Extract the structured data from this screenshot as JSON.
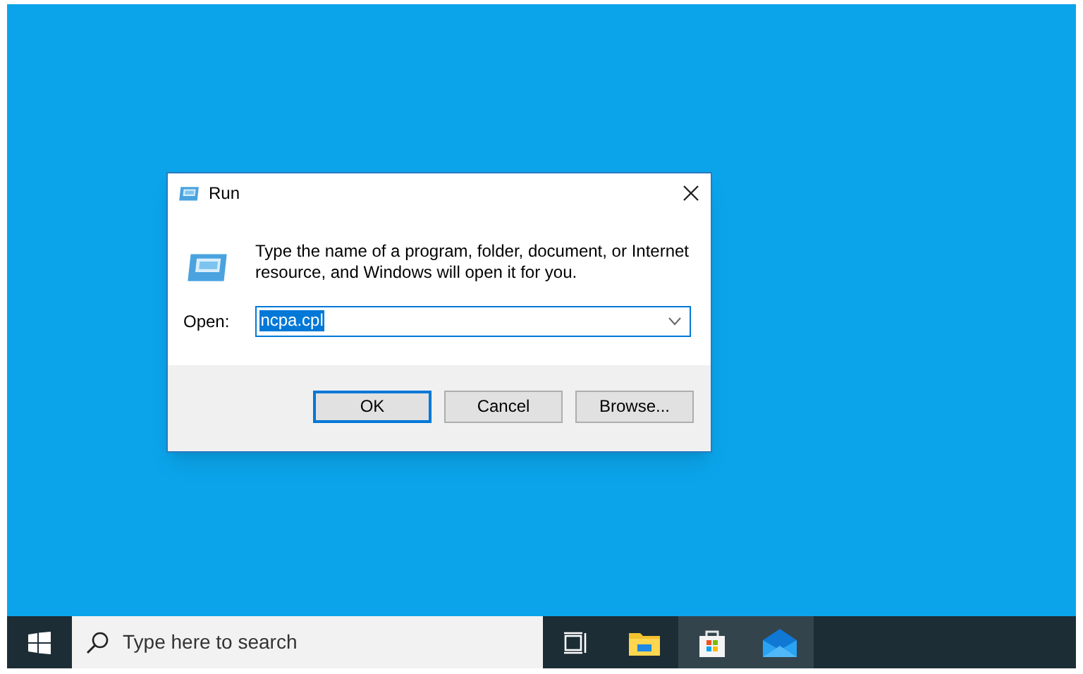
{
  "dialog": {
    "title": "Run",
    "message": "Type the name of a program, folder, document, or Internet resource, and Windows will open it for you.",
    "open_label": "Open:",
    "open_value": "ncpa.cpl",
    "buttons": [
      {
        "label": "OK",
        "default": true
      },
      {
        "label": "Cancel",
        "default": false
      },
      {
        "label": "Browse...",
        "default": false
      }
    ]
  },
  "taskbar": {
    "search": {
      "placeholder": "Type here to search"
    },
    "apps": [
      {
        "kind": "taskview",
        "running": false
      },
      {
        "kind": "explorer",
        "running": false
      },
      {
        "kind": "store",
        "running": true
      },
      {
        "kind": "mail",
        "running": true
      }
    ]
  }
}
